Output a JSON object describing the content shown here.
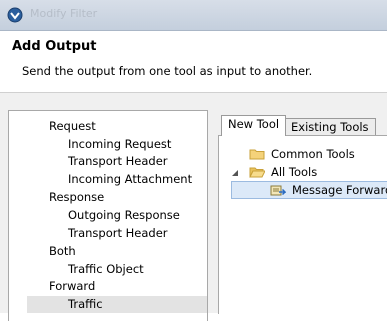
{
  "window": {
    "title": "Modify Filter"
  },
  "header": {
    "title": "Add Output",
    "description": "Send the output from one tool as input to another."
  },
  "left_list": {
    "items": [
      {
        "label": "Request",
        "level": 0
      },
      {
        "label": "Incoming Request",
        "level": 1
      },
      {
        "label": "Transport Header",
        "level": 1
      },
      {
        "label": "Incoming Attachment",
        "level": 1
      },
      {
        "label": "Response",
        "level": 0
      },
      {
        "label": "Outgoing Response",
        "level": 1
      },
      {
        "label": "Transport Header",
        "level": 1
      },
      {
        "label": "Both",
        "level": 0
      },
      {
        "label": "Traffic Object",
        "level": 1
      },
      {
        "label": "Forward",
        "level": 0
      },
      {
        "label": "Traffic",
        "level": 1,
        "selected": true
      }
    ]
  },
  "tabs": [
    {
      "label": "New Tool",
      "active": true
    },
    {
      "label": "Existing Tools",
      "active": false
    }
  ],
  "tree": {
    "items": [
      {
        "label": "Common Tools",
        "icon": "folder-closed-icon"
      },
      {
        "label": "All Tools",
        "icon": "folder-open-icon",
        "expanded": true
      },
      {
        "label": "Message Forward",
        "icon": "message-forward-icon",
        "selected": true
      }
    ]
  }
}
